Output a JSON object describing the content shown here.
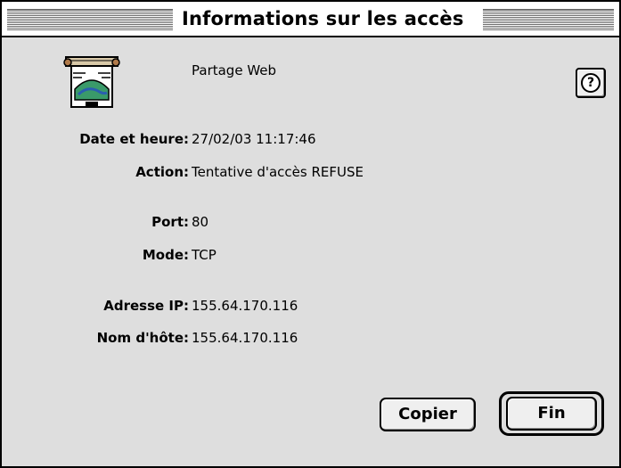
{
  "window": {
    "title": "Informations sur les accès"
  },
  "header": {
    "app_icon": "web-sharing-icon",
    "app_name": "Partage Web",
    "help_icon": "help-icon",
    "help_glyph": "?"
  },
  "fields": [
    {
      "label": "Date et heure",
      "value": "27/02/03 11:17:46"
    },
    {
      "label": "Action",
      "value": "Tentative d'accès REFUSE"
    },
    {
      "label": "Port",
      "value": "80"
    },
    {
      "label": "Mode",
      "value": "TCP"
    },
    {
      "label": "Adresse IP",
      "value": "155.64.170.116"
    },
    {
      "label": "Nom d'hôte",
      "value": "155.64.170.116"
    }
  ],
  "buttons": {
    "copy": "Copier",
    "done": "Fin"
  },
  "colors": {
    "window_bg": "#dedede",
    "border": "#000000",
    "button_bg": "#efefef"
  }
}
